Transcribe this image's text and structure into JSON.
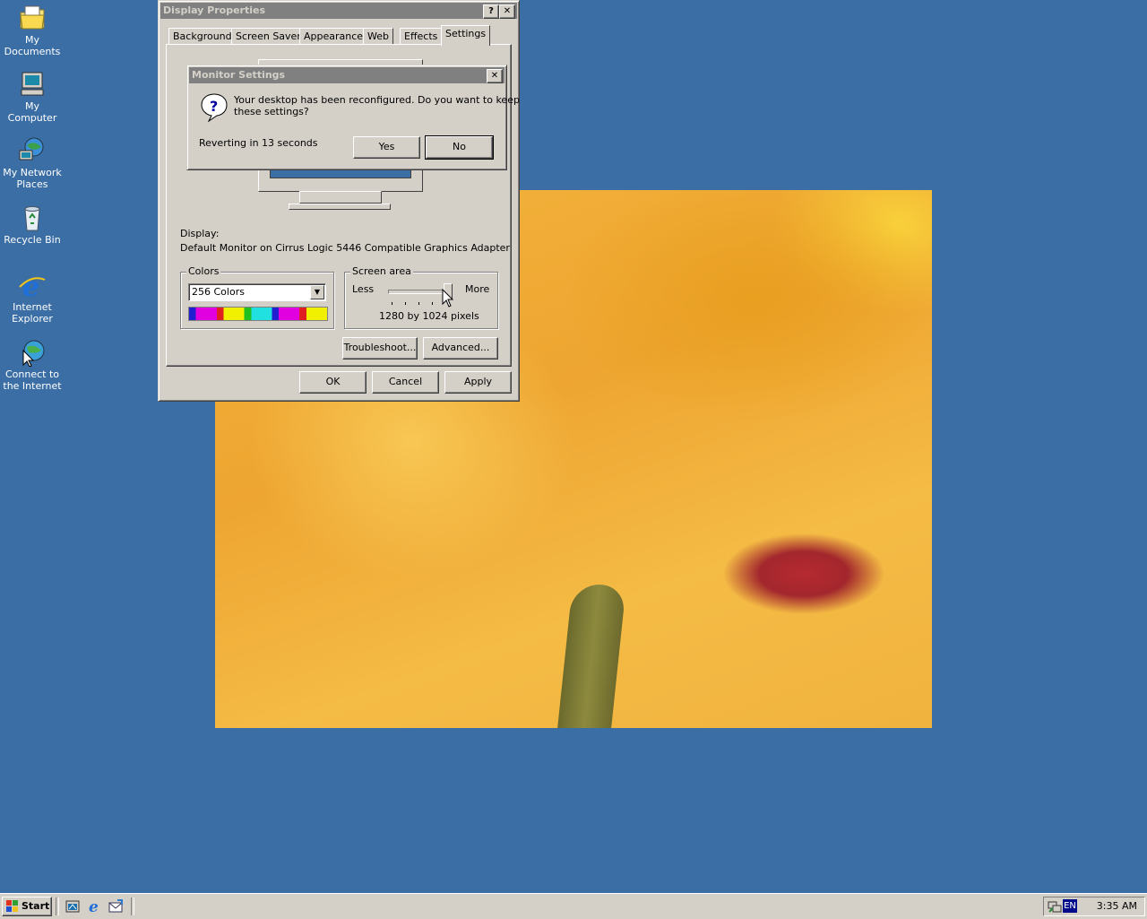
{
  "desktop": {
    "icons": [
      {
        "label_line1": "My Documents",
        "label_line2": "",
        "icon": "my-documents-icon"
      },
      {
        "label_line1": "My Computer",
        "label_line2": "",
        "icon": "my-computer-icon"
      },
      {
        "label_line1": "My Network",
        "label_line2": "Places",
        "icon": "network-places-icon"
      },
      {
        "label_line1": "Recycle Bin",
        "label_line2": "",
        "icon": "recycle-bin-icon"
      },
      {
        "label_line1": "Internet",
        "label_line2": "Explorer",
        "icon": "internet-explorer-icon"
      },
      {
        "label_line1": "Connect to",
        "label_line2": "the Internet",
        "icon": "connect-internet-icon"
      }
    ]
  },
  "display_properties": {
    "title": "Display Properties",
    "help_glyph": "?",
    "close_glyph": "✕",
    "tabs": [
      "Background",
      "Screen Saver",
      "Appearance",
      "Web",
      "Effects",
      "Settings"
    ],
    "active_tab": "Settings",
    "display_label": "Display:",
    "display_value": "Default Monitor on Cirrus Logic 5446 Compatible Graphics Adapter",
    "colors_group": "Colors",
    "colors_value": "256 Colors",
    "screen_area_group": "Screen area",
    "less_label": "Less",
    "more_label": "More",
    "resolution_text": "1280 by 1024 pixels",
    "slider_level": 1.0,
    "troubleshoot_label": "Troubleshoot...",
    "advanced_label": "Advanced...",
    "ok_label": "OK",
    "cancel_label": "Cancel",
    "apply_label": "Apply"
  },
  "monitor_settings": {
    "title": "Monitor Settings",
    "close_glyph": "✕",
    "message_line1": "Your desktop has been reconfigured.  Do you want to keep",
    "message_line2": "these settings?",
    "countdown": "Reverting in 13 seconds",
    "yes_label": "Yes",
    "no_label": "No"
  },
  "taskbar": {
    "start_label": "Start",
    "lang": "EN",
    "clock": "3:35 AM"
  },
  "colors": {
    "desktop": "#3a6ea5",
    "face": "#d4d0c8",
    "title_inactive": "#808080"
  }
}
